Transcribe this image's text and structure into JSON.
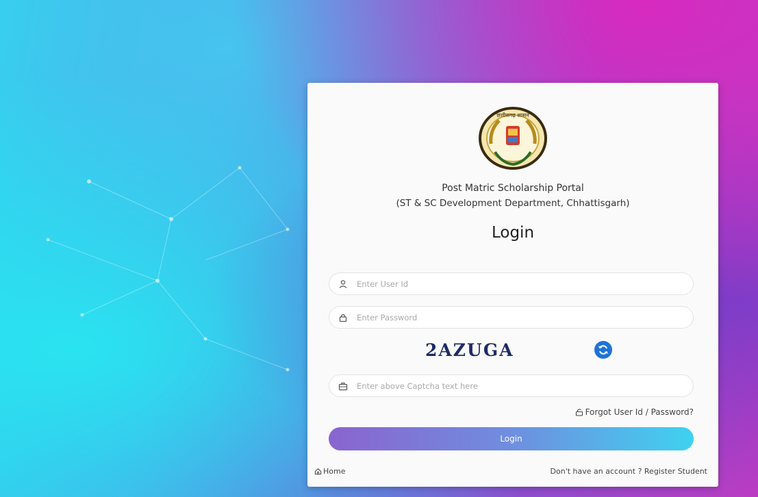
{
  "portal": {
    "title": "Post Matric Scholarship Portal",
    "subtitle": "(ST & SC Development Department, Chhattisgarh)",
    "emblem_text": "छत्तीसगढ़ शासन"
  },
  "login": {
    "heading": "Login",
    "userid_placeholder": "Enter User Id",
    "password_placeholder": "Enter Password",
    "captcha_text": "2AZUGA",
    "captcha_placeholder": "Enter above Captcha text here",
    "forgot_label": "Forgot User Id / Password?",
    "button_label": "Login"
  },
  "footer": {
    "home_label": "Home",
    "no_account_text": "Don't have an account ?",
    "register_label": "Register Student"
  },
  "icons": {
    "userid": "user-icon",
    "password": "lock-icon",
    "captcha": "briefcase-icon",
    "refresh": "refresh-icon",
    "forgot": "unlock-icon",
    "home": "home-icon"
  },
  "colors": {
    "login_button_start": "#8a64cf",
    "login_button_end": "#3fd2f0",
    "captcha_text": "#1f2a66",
    "refresh_button": "#1e73d6"
  }
}
